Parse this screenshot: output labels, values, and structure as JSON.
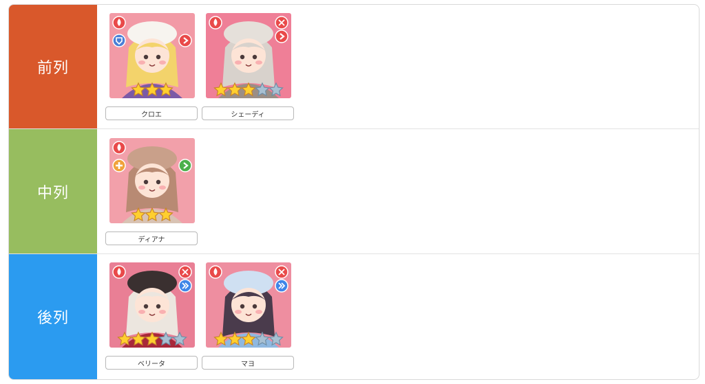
{
  "rows": [
    {
      "label": "前列",
      "color": "#d9582b",
      "characters": [
        {
          "name": "クロエ",
          "stars": 3,
          "max_stars": 3,
          "bg": "#f29aa6",
          "hair": "#f3d36b",
          "hat": "#f7f4ef",
          "outfit": "#7b5aa6",
          "role_icon": "shield-icon",
          "role_color": "#4a7fd6",
          "position_icon": "forward-arrow-icon",
          "position_color": "#e94a4a"
        },
        {
          "name": "シェーディ",
          "stars": 3,
          "max_stars": 5,
          "bg": "#ef7f97",
          "hair": "#d8d2cc",
          "hat": "#e5e0da",
          "outfit": "#9b8e86",
          "role_icon": "scissors-icon",
          "role_color": "#e94a4a",
          "position_icon": "forward-arrow-icon",
          "position_color": "#e94a4a"
        }
      ]
    },
    {
      "label": "中列",
      "color": "#97bd5f",
      "characters": [
        {
          "name": "ディアナ",
          "stars": 3,
          "max_stars": 3,
          "bg": "#f2a0aa",
          "hair": "#b88a73",
          "hat": "#c9a08a",
          "outfit": "#d9c3b4",
          "role_icon": "cross-icon",
          "role_color": "#f0a23a",
          "position_icon": "forward-arrow-icon",
          "position_color": "#4cb04c"
        }
      ]
    },
    {
      "label": "後列",
      "color": "#2b9bf0",
      "characters": [
        {
          "name": "ベリータ",
          "stars": 3,
          "max_stars": 5,
          "bg": "#e97f95",
          "hair": "#ece6df",
          "hat": "#3a3030",
          "outfit": "#a8283a",
          "role_icon": "scissors-icon",
          "role_color": "#e94a4a",
          "position_icon": "back-arrow-icon",
          "position_color": "#3f86e8"
        },
        {
          "name": "マヨ",
          "stars": 3,
          "max_stars": 5,
          "bg": "#ee8ea0",
          "hair": "#4a3b4c",
          "hat": "#cfe0f2",
          "outfit": "#8fb8e0",
          "role_icon": "scissors-icon",
          "role_color": "#e94a4a",
          "position_icon": "back-arrow-icon",
          "position_color": "#3f86e8"
        }
      ]
    }
  ]
}
